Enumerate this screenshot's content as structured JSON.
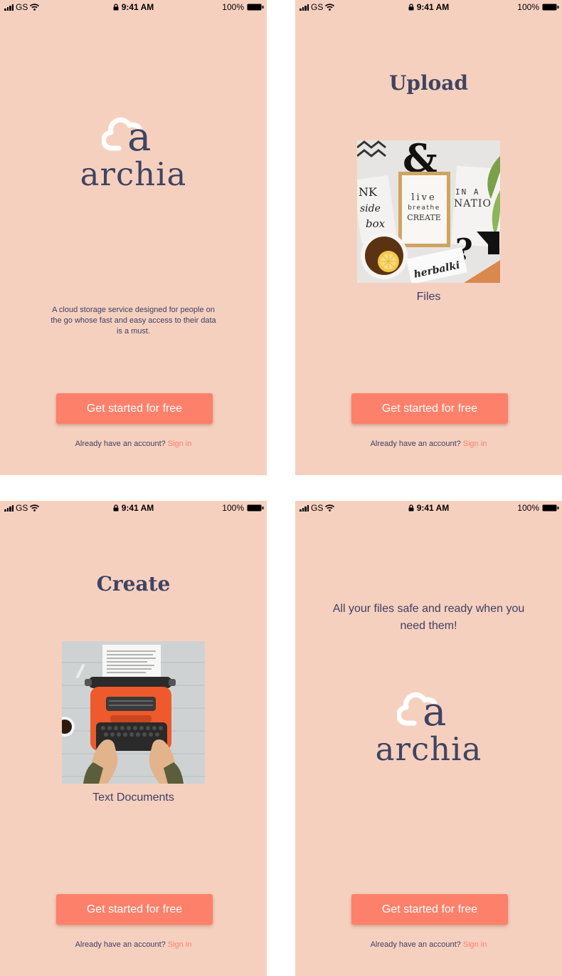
{
  "status_bar": {
    "carrier": "GS",
    "time": "9:41 AM",
    "battery": "100%"
  },
  "brand": {
    "name": "archia",
    "logo_letter": "a"
  },
  "colors": {
    "background": "#f6d0bf",
    "navy": "#3f4462",
    "accent": "#fd806a"
  },
  "screens": [
    {
      "tagline": "A cloud storage service designed for people on the go whose fast and easy access to their data is a must.",
      "cta_label": "Get started for free",
      "signin_prompt": "Already have an account?",
      "signin_link": "Sign in"
    },
    {
      "title": "Upload",
      "image_icon": "desk-photo",
      "image_text": {
        "ampersand": "&",
        "line1": "live",
        "line2": "breathe",
        "line3": "CREATE",
        "word": "herbalki",
        "frag1": "NK",
        "frag2": "side",
        "frag3": "box",
        "frag4": "IN A",
        "frag5": "NATIO",
        "question": "?"
      },
      "caption": "Files",
      "cta_label": "Get started for free",
      "signin_prompt": "Already have an account?",
      "signin_link": "Sign in"
    },
    {
      "title": "Create",
      "image_icon": "typewriter-photo",
      "caption": "Text Documents",
      "cta_label": "Get started for free",
      "signin_prompt": "Already have an account?",
      "signin_link": "Sign in"
    },
    {
      "headline": "All your files safe and ready when you need them!",
      "cta_label": "Get started for free",
      "signin_prompt": "Already have an account?",
      "signin_link": "Sign in"
    }
  ]
}
